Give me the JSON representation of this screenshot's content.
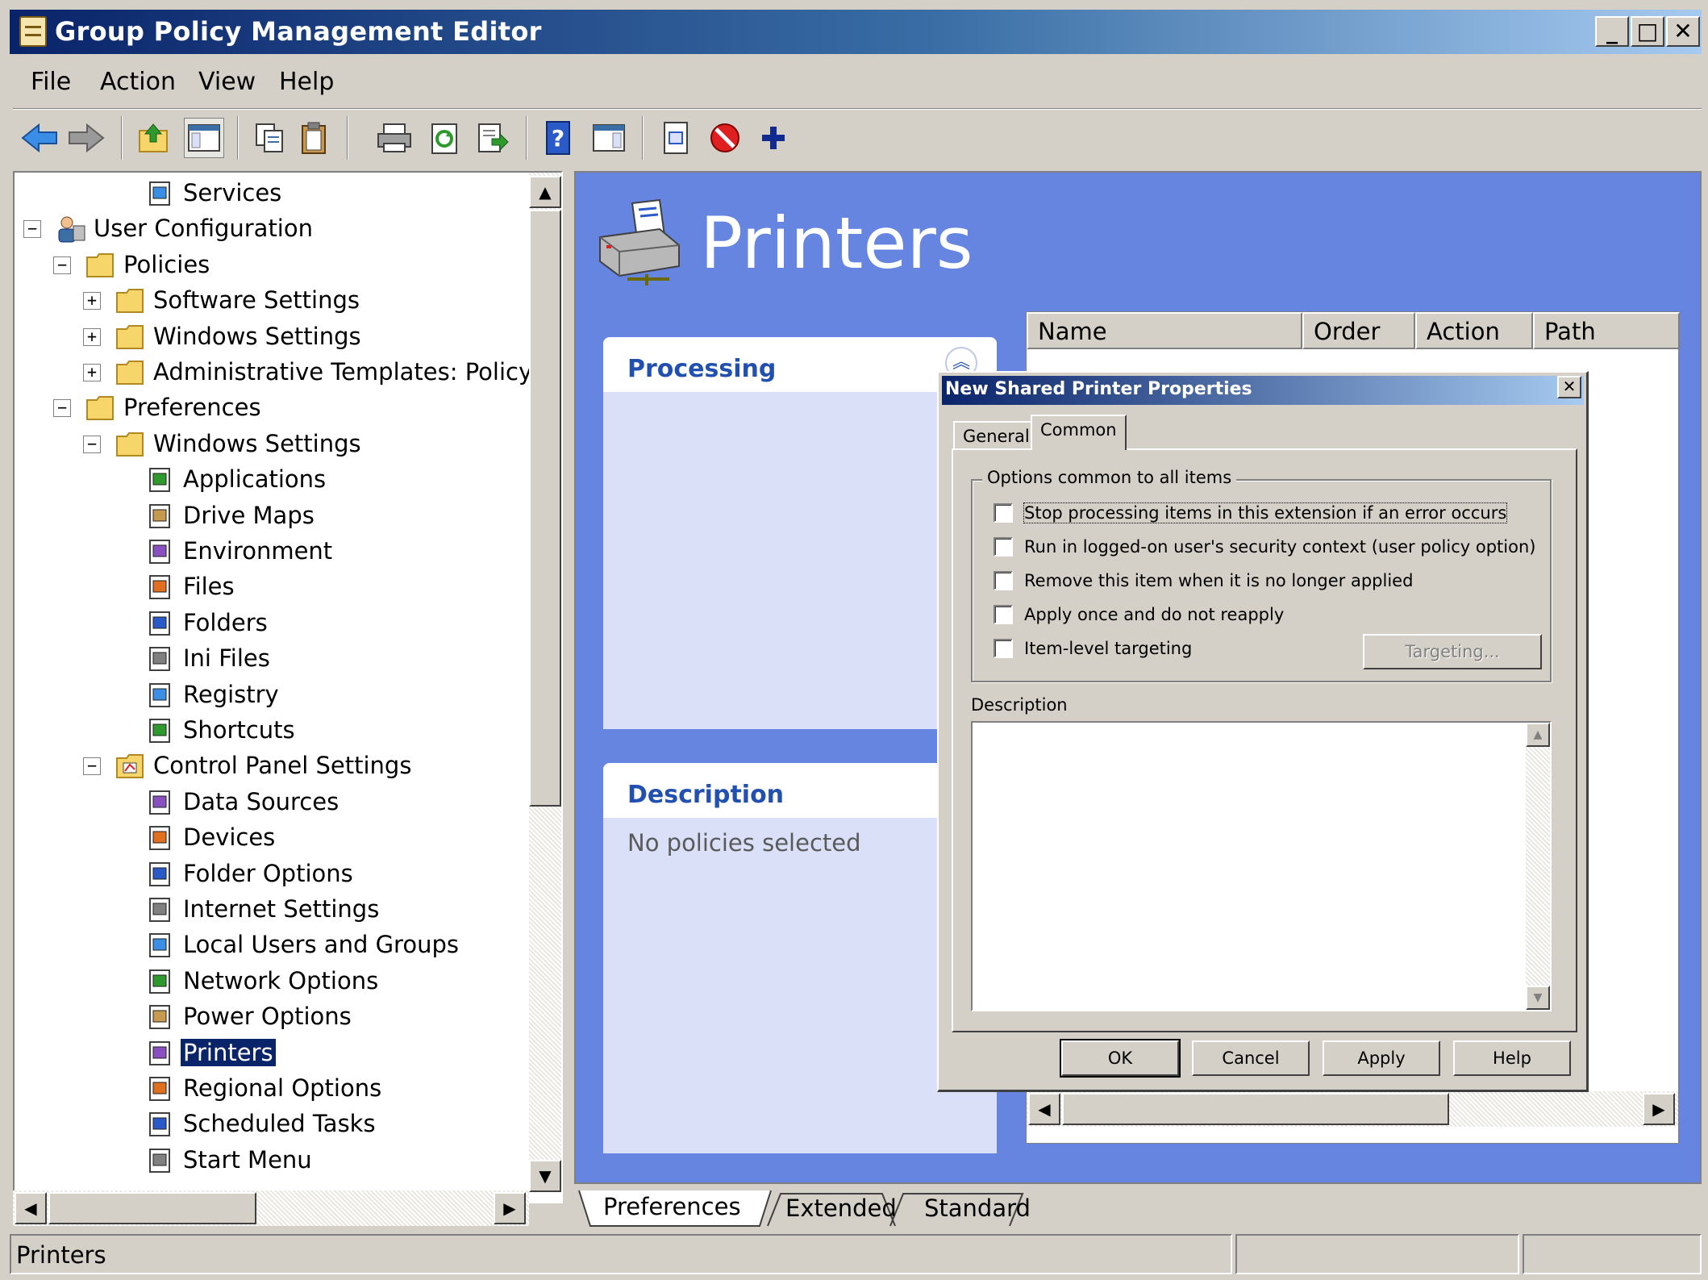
{
  "window": {
    "title": "Group Policy Management Editor",
    "minimize": "_",
    "maximize": "□",
    "close": "✕"
  },
  "menu": {
    "items": [
      {
        "label": "File"
      },
      {
        "label": "Action"
      },
      {
        "label": "View"
      },
      {
        "label": "Help"
      }
    ]
  },
  "toolbar": {
    "icons": [
      "back-arrow-icon",
      "forward-arrow-icon",
      "up-folder-icon",
      "show-hide-tree-icon",
      "copy-icon",
      "paste-icon",
      "print-icon",
      "refresh-icon",
      "export-list-icon",
      "help-icon",
      "show-hide-action-pane-icon",
      "properties-icon",
      "stop-icon",
      "add-icon"
    ]
  },
  "tree": {
    "items": [
      {
        "label": "Services",
        "indent": 4
      },
      {
        "label": "User Configuration",
        "indent": 1
      },
      {
        "label": "Policies",
        "indent": 2
      },
      {
        "label": "Software Settings",
        "indent": 3
      },
      {
        "label": "Windows Settings",
        "indent": 3
      },
      {
        "label": "Administrative Templates: Policy d",
        "indent": 3
      },
      {
        "label": "Preferences",
        "indent": 2
      },
      {
        "label": "Windows Settings",
        "indent": 3
      },
      {
        "label": "Applications",
        "indent": 4
      },
      {
        "label": "Drive Maps",
        "indent": 4
      },
      {
        "label": "Environment",
        "indent": 4
      },
      {
        "label": "Files",
        "indent": 4
      },
      {
        "label": "Folders",
        "indent": 4
      },
      {
        "label": "Ini Files",
        "indent": 4
      },
      {
        "label": "Registry",
        "indent": 4
      },
      {
        "label": "Shortcuts",
        "indent": 4
      },
      {
        "label": "Control Panel Settings",
        "indent": 3
      },
      {
        "label": "Data Sources",
        "indent": 4
      },
      {
        "label": "Devices",
        "indent": 4
      },
      {
        "label": "Folder Options",
        "indent": 4
      },
      {
        "label": "Internet Settings",
        "indent": 4
      },
      {
        "label": "Local Users and Groups",
        "indent": 4
      },
      {
        "label": "Network Options",
        "indent": 4
      },
      {
        "label": "Power Options",
        "indent": 4
      },
      {
        "label": "Printers",
        "indent": 4,
        "selected": true
      },
      {
        "label": "Regional Options",
        "indent": 4
      },
      {
        "label": "Scheduled Tasks",
        "indent": 4
      },
      {
        "label": "Start Menu",
        "indent": 4
      }
    ],
    "expand_minus": "−",
    "expand_plus": "+"
  },
  "main": {
    "title": "Printers",
    "processing_heading": "Processing",
    "description_heading": "Description",
    "description_text": "No policies selected",
    "columns": [
      "Name",
      "Order",
      "Action",
      "Path"
    ]
  },
  "bottom_tabs": [
    "Preferences",
    "Extended",
    "Standard"
  ],
  "status": {
    "text": "Printers"
  },
  "dialog": {
    "title": "New Shared Printer Properties",
    "close": "✕",
    "tabs": [
      "General",
      "Common"
    ],
    "group_label": "Options common to all items",
    "options": [
      {
        "label": "Stop processing items in this extension if an error occurs",
        "checked": false
      },
      {
        "label": "Run in logged-on user's security context (user policy option)",
        "checked": false
      },
      {
        "label": "Remove this item when it is no longer applied",
        "checked": false
      },
      {
        "label": "Apply once and do not reapply",
        "checked": false
      },
      {
        "label": "Item-level targeting",
        "checked": false
      }
    ],
    "targeting_button": "Targeting...",
    "description_label": "Description",
    "buttons": {
      "ok": "OK",
      "cancel": "Cancel",
      "apply": "Apply",
      "help": "Help"
    }
  },
  "colors": {
    "title_bar": "#0a246a",
    "content_bg": "#6585e0",
    "heading_text": "#2150b0",
    "selection": "#0a246a"
  }
}
